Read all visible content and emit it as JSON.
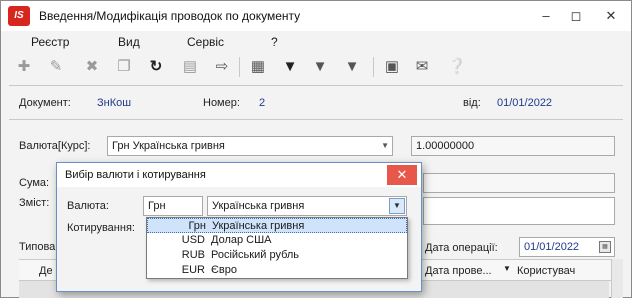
{
  "window": {
    "title": "Введення/Модифікація проводок по документу",
    "app_icon_text": "IS"
  },
  "menubar": {
    "items": [
      "Реєстр",
      "Вид",
      "Сервіс",
      "?"
    ]
  },
  "toolbar": {
    "icons": [
      "add-icon",
      "edit-icon",
      "delete-icon",
      "copy-icon",
      "refresh-icon",
      "print-icon",
      "exit-icon",
      "grid-icon",
      "filter-icon",
      "filter-edit-icon",
      "filter-clear-icon",
      "document-icon",
      "mail-icon",
      "help-icon"
    ]
  },
  "document": {
    "doc_label": "Документ:",
    "doc_value": "ЗнКош",
    "number_label": "Номер:",
    "number_value": "2",
    "date_label": "від:",
    "date_value": "01/01/2022"
  },
  "currency": {
    "label": "Валюта[Курс]:",
    "value": "Грн Українська гривня",
    "rate": "1.00000000"
  },
  "sum": {
    "label": "Сума:"
  },
  "content": {
    "label": "Зміст:"
  },
  "typical": {
    "label": "Типова"
  },
  "operation_date": {
    "label": "Дата операції:",
    "value": "01/01/2022"
  },
  "grid": {
    "columns": [
      "Де",
      "Дата прове...",
      "Користувач"
    ]
  },
  "dialog": {
    "title": "Вибір валюти і котирування",
    "currency_label": "Валюта:",
    "currency_code": "Грн",
    "currency_name": "Українська гривня",
    "quote_label": "Котирування:",
    "options": [
      {
        "code": "Грн",
        "name": "Українська гривня"
      },
      {
        "code": "USD",
        "name": "Долар США"
      },
      {
        "code": "RUB",
        "name": "Російський рубль"
      },
      {
        "code": "EUR",
        "name": "Євро"
      }
    ]
  }
}
